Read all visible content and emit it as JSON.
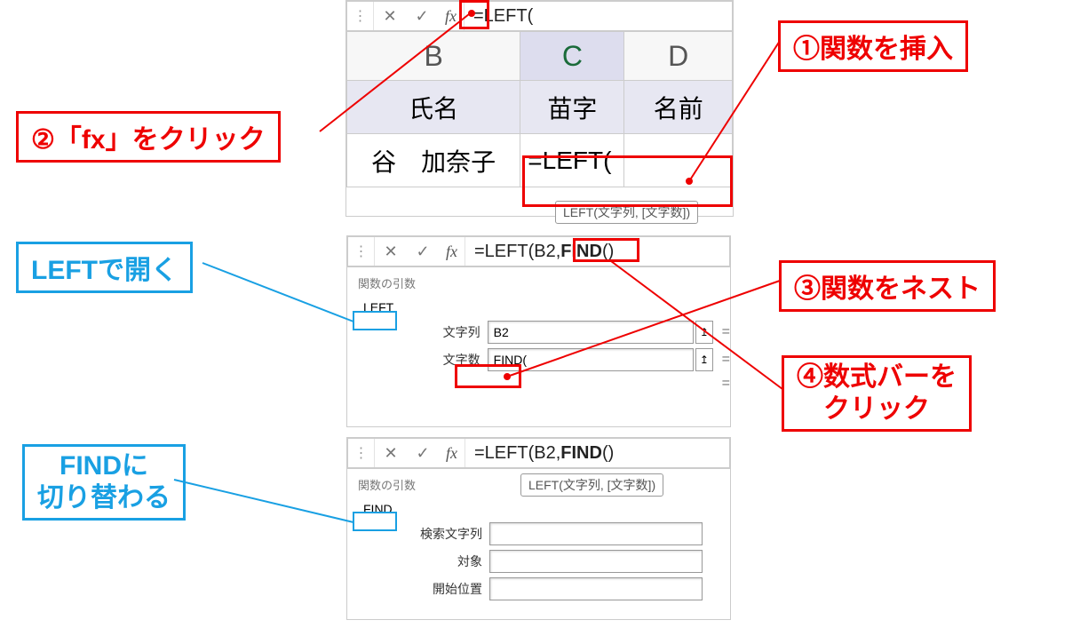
{
  "panel1": {
    "formula_bar": {
      "text": "=LEFT("
    },
    "columns": {
      "B": "B",
      "C": "C",
      "D": "D"
    },
    "header_row": {
      "B": "氏名",
      "C": "苗字",
      "D": "名前"
    },
    "data_row": {
      "B": "谷　加奈子",
      "C": "=LEFT("
    },
    "tooltip": "LEFT(文字列, [文字数])"
  },
  "panel2": {
    "formula_bar": {
      "prefix": "=LEFT(B2,",
      "bold": "FIND",
      "suffix": "()"
    },
    "args_title": "関数の引数",
    "fn_name": "LEFT",
    "args": {
      "str_label": "文字列",
      "str_value": "B2",
      "num_label": "文字数",
      "num_value": "FIND("
    }
  },
  "panel3": {
    "formula_bar": {
      "prefix": "=LEFT(B2,",
      "bold": "FIND",
      "suffix": "()"
    },
    "args_title": "関数の引数",
    "fn_name": "FIND",
    "tooltip": "LEFT(文字列, [文字数])",
    "args": {
      "search_label": "検索文字列",
      "target_label": "対象",
      "start_label": "開始位置"
    }
  },
  "callouts": {
    "c1": "①関数を挿入",
    "c2": "②「fx」をクリック",
    "c3": "③関数をネスト",
    "c4_l1": "④数式バーを",
    "c4_l2": "クリック",
    "b1": "LEFTで開く",
    "b2_l1": "FINDに",
    "b2_l2": "切り替わる"
  },
  "icons": {
    "fx": "fx",
    "cancel": "✕",
    "enter": "✓",
    "more": "⋮",
    "ref": "↥",
    "equals": "="
  }
}
